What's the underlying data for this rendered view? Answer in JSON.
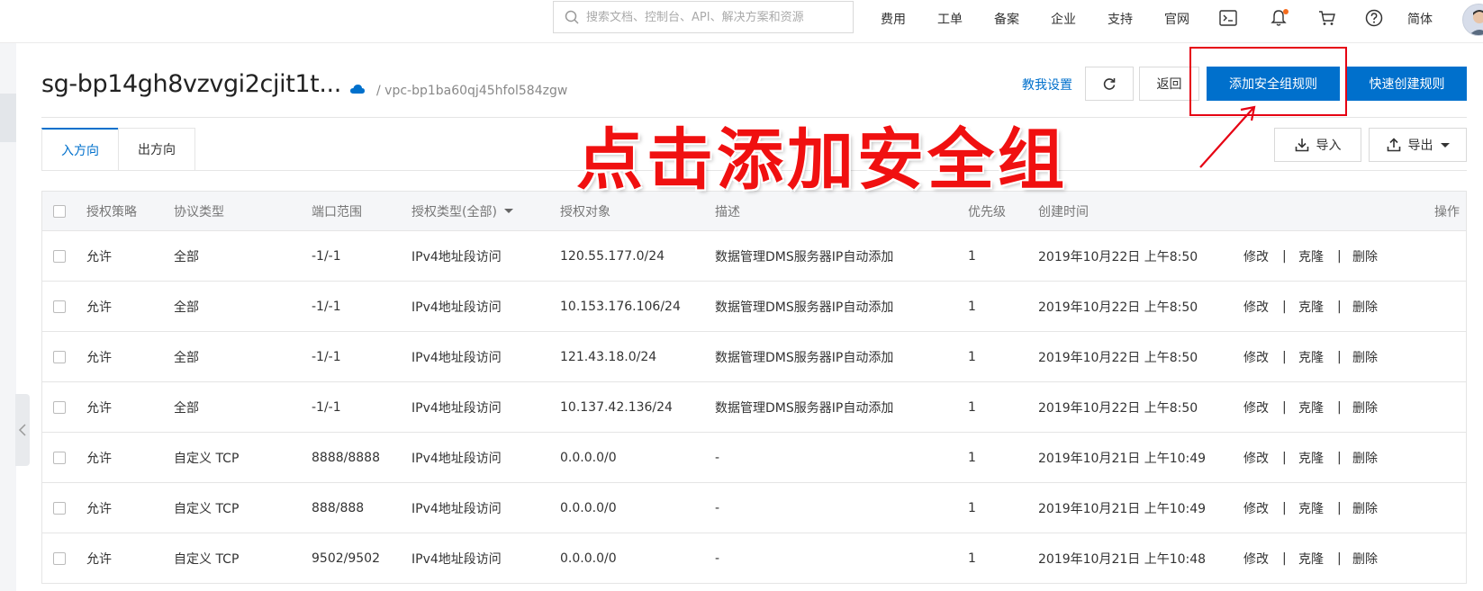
{
  "topbar": {
    "search_placeholder": "搜索文档、控制台、API、解决方案和资源",
    "nav": [
      "费用",
      "工单",
      "备案",
      "企业",
      "支持",
      "官网"
    ],
    "lang": "简体",
    "icons": [
      "terminal-icon",
      "bell-icon",
      "cart-icon",
      "help-icon"
    ],
    "notification_dot_color": "#f56c1d"
  },
  "header": {
    "sg_id": "sg-bp14gh8vzvgi2cjit1t...",
    "vpc_path": "/ vpc-bp1ba60qj45hfol584zgw",
    "teach_link": "教我设置",
    "back_label": "返回",
    "add_rule_label": "添加安全组规则",
    "quick_create_label": "快速创建规则",
    "import_label": "导入",
    "export_label": "导出"
  },
  "annotation": {
    "text": "点击添加安全组",
    "color": "#e60012"
  },
  "tabs": [
    "入方向",
    "出方向"
  ],
  "active_tab": 0,
  "table": {
    "headers": [
      "授权策略",
      "协议类型",
      "端口范围",
      "授权类型(全部)",
      "授权对象",
      "描述",
      "优先级",
      "创建时间",
      "操作"
    ],
    "rows": [
      {
        "policy": "允许",
        "protocol": "全部",
        "port": "-1/-1",
        "auth_type": "IPv4地址段访问",
        "object": "120.55.177.0/24",
        "desc": "数据管理DMS服务器IP自动添加",
        "priority": "1",
        "created": "2019年10月22日 上午8:50"
      },
      {
        "policy": "允许",
        "protocol": "全部",
        "port": "-1/-1",
        "auth_type": "IPv4地址段访问",
        "object": "10.153.176.106/24",
        "desc": "数据管理DMS服务器IP自动添加",
        "priority": "1",
        "created": "2019年10月22日 上午8:50"
      },
      {
        "policy": "允许",
        "protocol": "全部",
        "port": "-1/-1",
        "auth_type": "IPv4地址段访问",
        "object": "121.43.18.0/24",
        "desc": "数据管理DMS服务器IP自动添加",
        "priority": "1",
        "created": "2019年10月22日 上午8:50"
      },
      {
        "policy": "允许",
        "protocol": "全部",
        "port": "-1/-1",
        "auth_type": "IPv4地址段访问",
        "object": "10.137.42.136/24",
        "desc": "数据管理DMS服务器IP自动添加",
        "priority": "1",
        "created": "2019年10月22日 上午8:50"
      },
      {
        "policy": "允许",
        "protocol": "自定义 TCP",
        "port": "8888/8888",
        "auth_type": "IPv4地址段访问",
        "object": "0.0.0.0/0",
        "desc": "-",
        "priority": "1",
        "created": "2019年10月21日 上午10:49"
      },
      {
        "policy": "允许",
        "protocol": "自定义 TCP",
        "port": "888/888",
        "auth_type": "IPv4地址段访问",
        "object": "0.0.0.0/0",
        "desc": "-",
        "priority": "1",
        "created": "2019年10月21日 上午10:49"
      },
      {
        "policy": "允许",
        "protocol": "自定义 TCP",
        "port": "9502/9502",
        "auth_type": "IPv4地址段访问",
        "object": "0.0.0.0/0",
        "desc": "-",
        "priority": "1",
        "created": "2019年10月21日 上午10:48"
      }
    ],
    "actions": [
      "修改",
      "克隆",
      "删除"
    ],
    "action_separator": "|"
  },
  "colors": {
    "primary": "#0070cc",
    "link": "#0070cc",
    "header_bg": "#f5f6f8"
  }
}
